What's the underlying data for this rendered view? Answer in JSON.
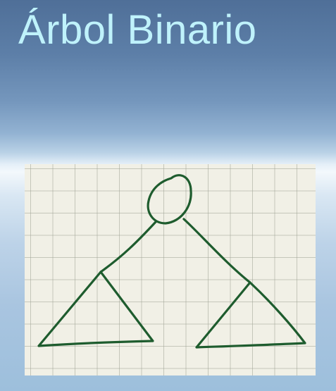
{
  "slide": {
    "title": "Árbol Binario"
  },
  "sketch": {
    "stroke_color": "#1e5c2e",
    "paper_color": "#f1f0e6",
    "grid_color": "#a0a596"
  },
  "colors": {
    "title_text": "#bff2fb",
    "background_top": "#4f6f98",
    "background_bottom": "#9dbfdc"
  }
}
